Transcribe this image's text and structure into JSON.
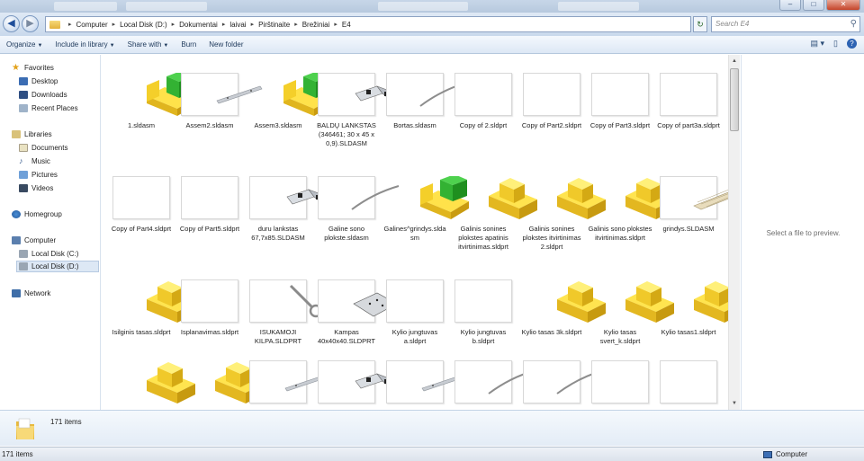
{
  "window": {
    "controls": [
      "–",
      "□",
      "✕"
    ]
  },
  "address": {
    "crumbs": [
      "Computer",
      "Local Disk (D:)",
      "Dokumentai",
      "laivai",
      "Pirštinaite",
      "Brežiniai",
      "E4"
    ]
  },
  "search": {
    "placeholder": "Search E4"
  },
  "toolbar": {
    "organize": "Organize",
    "include": "Include in library",
    "share": "Share with",
    "burn": "Burn",
    "new_folder": "New folder"
  },
  "nav": {
    "favorites": "Favorites",
    "desktop": "Desktop",
    "downloads": "Downloads",
    "recent": "Recent Places",
    "libraries": "Libraries",
    "documents": "Documents",
    "music": "Music",
    "pictures": "Pictures",
    "videos": "Videos",
    "homegroup": "Homegroup",
    "computer": "Computer",
    "disk_c": "Local Disk (C:)",
    "disk_d": "Local Disk (D:)",
    "network": "Network"
  },
  "files": [
    {
      "label": "1.sldasm",
      "kind": "asm"
    },
    {
      "label": "Assem2.sldasm",
      "kind": "bar"
    },
    {
      "label": "Assem3.sldasm",
      "kind": "asm"
    },
    {
      "label": "BALDŲ LANKSTAS (346461; 30 x 45 x 0,9).SLDASM",
      "kind": "hinge"
    },
    {
      "label": "Bortas.sldasm",
      "kind": "arc"
    },
    {
      "label": "Copy of 2.sldprt",
      "kind": "blank"
    },
    {
      "label": "Copy of Part2.sldprt",
      "kind": "blank"
    },
    {
      "label": "Copy of Part3.sldprt",
      "kind": "blank"
    },
    {
      "label": "Copy of part3a.sldprt",
      "kind": "blank"
    },
    {
      "label": "Copy of Part4.sldprt",
      "kind": "blank"
    },
    {
      "label": "Copy of Part5.sldprt",
      "kind": "blank"
    },
    {
      "label": "duru lankstas 67,7x85.SLDASM",
      "kind": "hinge"
    },
    {
      "label": "Galine sono plokste.sldasm",
      "kind": "arc"
    },
    {
      "label": "Galines^grindys.sldasm",
      "kind": "asm"
    },
    {
      "label": "Galinis sonines plokstes apatinis itvirtinimas.sldprt",
      "kind": "part"
    },
    {
      "label": "Galinis sonines plokstes itvirtinimas 2.sldprt",
      "kind": "part"
    },
    {
      "label": "Galinis sono plokstes itvirtinimas.sldprt",
      "kind": "part"
    },
    {
      "label": "grindys.SLDASM",
      "kind": "grid"
    },
    {
      "label": "Isilginis tasas.sldprt",
      "kind": "part"
    },
    {
      "label": "Isplanavimas.sldprt",
      "kind": "blank"
    },
    {
      "label": "ISUKAMOJI KILPA.SLDPRT",
      "kind": "eye"
    },
    {
      "label": "Kampas 40x40x40.SLDPRT",
      "kind": "plate"
    },
    {
      "label": "Kylio jungtuvas a.sldprt",
      "kind": "blank"
    },
    {
      "label": "Kylio jungtuvas b.sldprt",
      "kind": "blank"
    },
    {
      "label": "Kylio tasas 3k.sldprt",
      "kind": "part"
    },
    {
      "label": "Kylio tasas svert_k.sldprt",
      "kind": "part"
    },
    {
      "label": "Kylio tasas1.sldprt",
      "kind": "part"
    },
    {
      "label": "",
      "kind": "part"
    },
    {
      "label": "",
      "kind": "part"
    },
    {
      "label": "",
      "kind": "bar"
    },
    {
      "label": "",
      "kind": "hinge"
    },
    {
      "label": "",
      "kind": "bar"
    },
    {
      "label": "",
      "kind": "arc"
    },
    {
      "label": "",
      "kind": "arc"
    },
    {
      "label": "",
      "kind": "blank"
    },
    {
      "label": "",
      "kind": "blank"
    }
  ],
  "preview": {
    "message": "Select a file to preview."
  },
  "details": {
    "count": "171 items"
  },
  "status": {
    "items": "171 items",
    "location": "Computer"
  }
}
